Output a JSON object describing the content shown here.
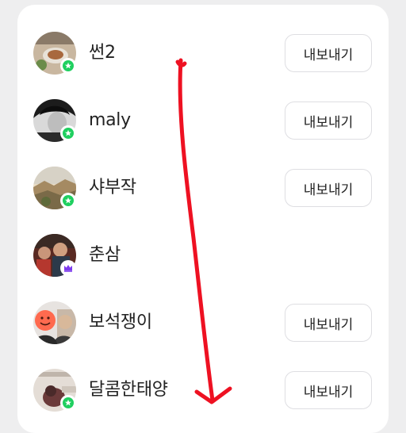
{
  "members": [
    {
      "name": "썬2",
      "badge": "star-badge-icon",
      "button": "내보내기",
      "avatar_icon": "food-photo-avatar"
    },
    {
      "name": "maly",
      "badge": "star-badge-icon",
      "button": "내보내기",
      "avatar_icon": "bw-portrait-avatar"
    },
    {
      "name": "샤부작",
      "badge": "star-badge-icon",
      "button": "내보내기",
      "avatar_icon": "landscape-avatar"
    },
    {
      "name": "춘삼",
      "badge": "crown-badge-icon",
      "button": "",
      "avatar_icon": "people-photo-avatar"
    },
    {
      "name": "보석쟁이",
      "badge": "",
      "button": "내보내기",
      "avatar_icon": "smiley-covered-avatar"
    },
    {
      "name": "달콤한태양",
      "badge": "star-badge-icon",
      "button": "내보내기",
      "avatar_icon": "doll-photo-avatar"
    }
  ],
  "colors": {
    "star_badge": "#1fcf5f",
    "crown_badge": "#7c3aed",
    "annotation_arrow": "#ee1122"
  },
  "annotation": {
    "icon": "red-hand-drawn-down-arrow"
  }
}
